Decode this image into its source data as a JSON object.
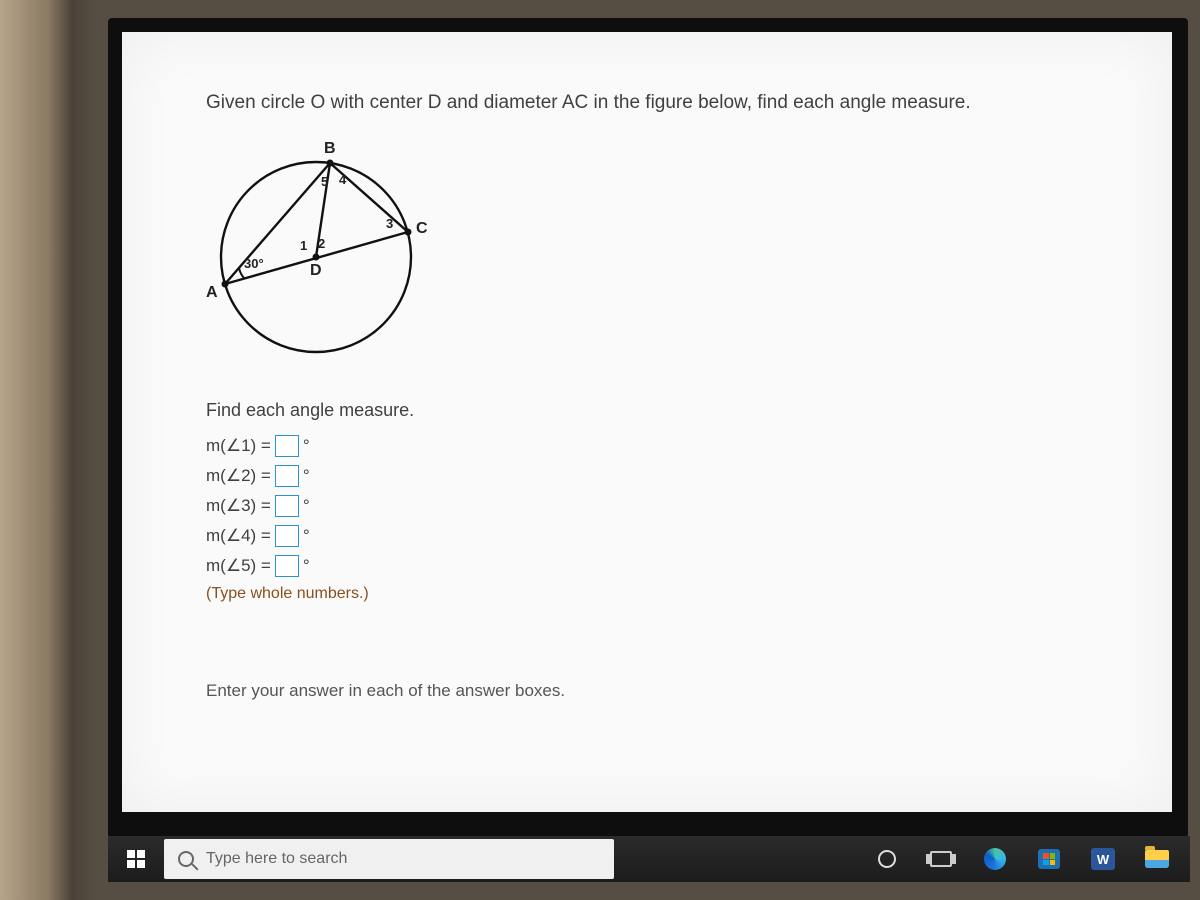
{
  "question": "Given circle O with center D and diameter AC in the figure below, find each angle measure.",
  "diagram": {
    "labels": {
      "A": "A",
      "B": "B",
      "C": "C",
      "D": "D",
      "a1": "1",
      "a2": "2",
      "a3": "3",
      "a4": "4",
      "a5": "5",
      "angleA": "30°"
    }
  },
  "instruction": "Find each angle measure.",
  "answers": [
    {
      "label": "m(∠1) =",
      "value": "",
      "unit": "°"
    },
    {
      "label": "m(∠2) =",
      "value": "",
      "unit": "°"
    },
    {
      "label": "m(∠3) =",
      "value": "",
      "unit": "°"
    },
    {
      "label": "m(∠4) =",
      "value": "",
      "unit": "°"
    },
    {
      "label": "m(∠5) =",
      "value": "",
      "unit": "°"
    }
  ],
  "hint": "(Type whole numbers.)",
  "footer": "Enter your answer in each of the answer boxes.",
  "taskbar": {
    "search_placeholder": "Type here to search",
    "word_label": "W"
  }
}
